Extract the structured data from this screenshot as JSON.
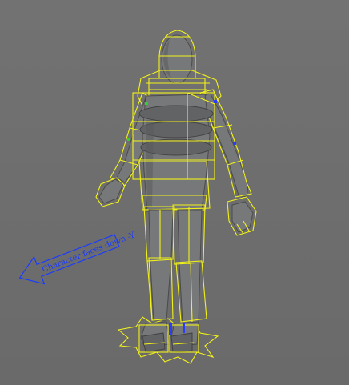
{
  "viewport": {
    "direction_label": "Character faces down -Y"
  },
  "colors": {
    "background": "#6e6e6e",
    "selection_wire": "#f2f21a",
    "mesh": "#777879",
    "direction_arrow": "#1a3cff",
    "joint_marker_green": "#2ad42a",
    "joint_marker_blue": "#2a3cff"
  },
  "icons": [
    "character-mesh",
    "direction-arrow",
    "ground-star-icon"
  ]
}
